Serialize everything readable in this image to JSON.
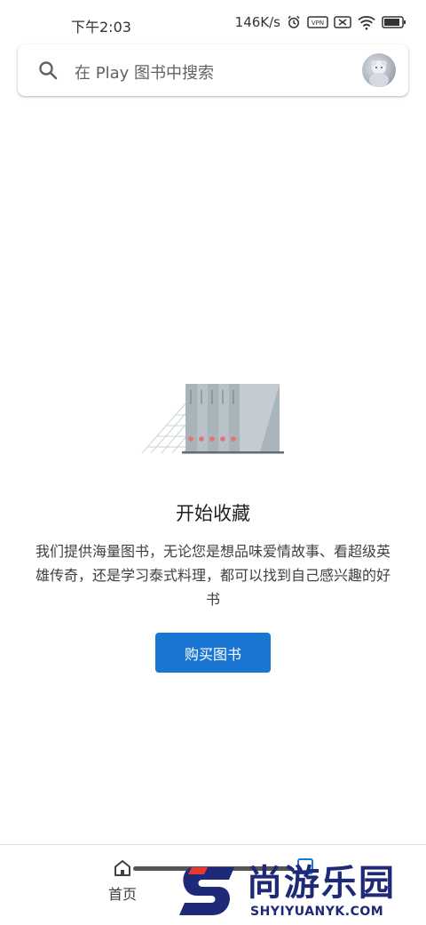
{
  "status_bar": {
    "time": "下午2:03",
    "network_speed": "146K/s",
    "icons": [
      "alarm-icon",
      "vpn-icon",
      "sim-off-icon",
      "wifi-icon",
      "battery-icon"
    ]
  },
  "search": {
    "placeholder": "在 Play 图书中搜索",
    "icon": "search-icon"
  },
  "empty_state": {
    "title": "开始收藏",
    "description": "我们提供海量图书，无论您是想品味爱情故事、看超级英雄传奇，还是学习泰式料理，都可以找到自己感兴趣的好书",
    "button_label": "购买图书"
  },
  "bottom_nav": {
    "home_label": "首页",
    "home_icon": "home-icon",
    "library_icon": "library-icon"
  },
  "watermark": {
    "text": "尚游乐园",
    "sub": "SHYIYUANYK.COM"
  },
  "colors": {
    "accent": "#1976d2",
    "watermark": "#1e2a78",
    "watermark_red": "#e53935"
  }
}
